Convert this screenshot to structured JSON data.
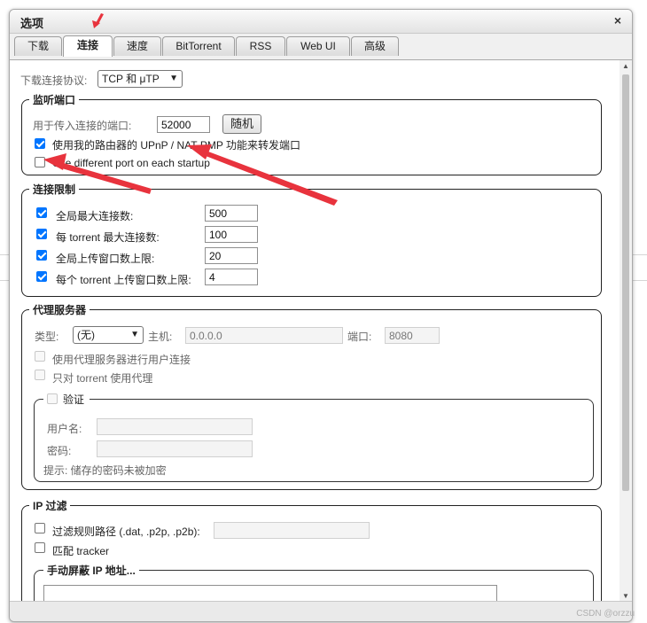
{
  "dialog": {
    "title": "选项",
    "close": "×"
  },
  "tabs": [
    {
      "label": "下载"
    },
    {
      "label": "连接"
    },
    {
      "label": "速度"
    },
    {
      "label": "BitTorrent"
    },
    {
      "label": "RSS"
    },
    {
      "label": "Web UI"
    },
    {
      "label": "高级"
    }
  ],
  "active_tab": "连接",
  "protocol": {
    "label": "下载连接协议:",
    "value": "TCP 和 μTP"
  },
  "listening": {
    "legend": "监听端口",
    "port_label": "用于传入连接的端口:",
    "port_value": "52000",
    "random_button": "随机",
    "upnp_label": "使用我的路由器的 UPnP / NAT-PMP 功能来转发端口",
    "upnp_checked": true,
    "diff_port_label": "Use different port on each startup",
    "diff_port_checked": false
  },
  "limits": {
    "legend": "连接限制",
    "rows": [
      {
        "label": "全局最大连接数:",
        "value": "500",
        "checked": true
      },
      {
        "label": "每 torrent 最大连接数:",
        "value": "100",
        "checked": true
      },
      {
        "label": "全局上传窗口数上限:",
        "value": "20",
        "checked": true
      },
      {
        "label": "每个 torrent 上传窗口数上限:",
        "value": "4",
        "checked": true
      }
    ]
  },
  "proxy": {
    "legend": "代理服务器",
    "type_label": "类型:",
    "type_value": "(无)",
    "host_label": "主机:",
    "host_value": "0.0.0.0",
    "port_label": "端口:",
    "port_value": "8080",
    "peer_label": "使用代理服务器进行用户连接",
    "torrent_only_label": "只对 torrent 使用代理",
    "auth": {
      "legend": "验证",
      "username_label": "用户名:",
      "password_label": "密码:",
      "hint": "提示: 储存的密码未被加密"
    }
  },
  "ipfilter": {
    "legend": "IP 过滤",
    "path_label": "过滤规则路径 (.dat, .p2p, .p2b):",
    "tracker_label": "匹配 tracker",
    "manual_legend": "手动屏蔽 IP 地址..."
  },
  "watermark": "CSDN @orzzu",
  "colors": {
    "annotation_arrow": "#e8333d",
    "checkbox_accent": "#0075ff"
  }
}
